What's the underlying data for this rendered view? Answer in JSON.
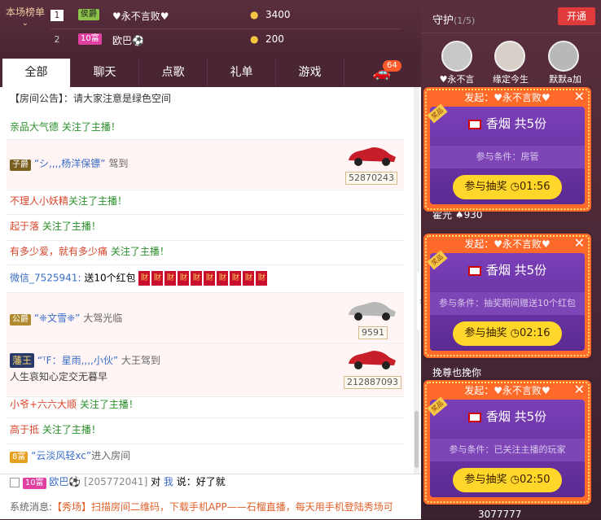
{
  "rank": {
    "label": "本场榜单",
    "chevron": "⌄",
    "rows": [
      {
        "n": "1",
        "badge": "侯爵",
        "name": "♥永不言败♥",
        "amount": "3400"
      },
      {
        "n": "2",
        "badge": "10富",
        "name": "欧巴⚽",
        "amount": "200"
      }
    ]
  },
  "tabs": [
    "全部",
    "聊天",
    "点歌",
    "礼单",
    "游戏"
  ],
  "car_badge": "64",
  "chat": {
    "notice_label": "【房间公告】：",
    "notice": "请大家注意是绿色空间",
    "partial": "亲品大气德 关注了主播！",
    "enter1_badge": "子爵",
    "enter1_name": "“シ,,,,杨洋保镖”",
    "enter1_action": "驾到",
    "enter1_plate": "52870243",
    "f1_name": "不理人小妖精",
    "f1_action": "关注了主播！",
    "f2_name": "起于落",
    "f2_action": "关注了主播！",
    "f3_name": "有多少爱，就有多少痛",
    "f3_action": "关注了主播！",
    "rp_name": "微信_7525941:",
    "rp_text": "送10个红包",
    "rp_char": "财",
    "enter2_badge": "公爵",
    "enter2_name": "“❈文雪❈”",
    "enter2_action": "大驾光临",
    "enter2_plate": "9591",
    "enter3_badge": "藩王",
    "enter3_name": "“ᵀF：星雨,,,,小伙”",
    "enter3_action": "大王驾到",
    "enter3_sub": "人生哀知心定交无暮早",
    "enter3_plate": "212887093",
    "f4_name": "小爷+六六大顺",
    "f4_action": "关注了主播！",
    "f5_name": "高于抵",
    "f5_action": "关注了主播！",
    "enter4_badge": "8富",
    "enter4_name": "“云淡风轻xc”",
    "enter4_action": "进入房间"
  },
  "bottom": {
    "badge": "10富",
    "name": "欧巴⚽",
    "id": "[205772041]",
    "to": "对",
    "me": "我",
    "say": "说：",
    "text": "好了就",
    "sys_label": "系统消息:",
    "sys_text": "【秀场】扫描房间二维码，下载手机APP——石榴直播，每天用手机登陆秀场可"
  },
  "guard": {
    "title": "守护",
    "count": "(1/5)",
    "open": "开通",
    "avatars": [
      "♥永不言",
      "缘定今生",
      "默默a加"
    ]
  },
  "right_list": {
    "row1": "霍光 ♠930",
    "row2": "挽尊也挽你",
    "row3": "3077777"
  },
  "popups": [
    {
      "from": "发起：♥永不言败♥",
      "prize": "香烟 共5份",
      "cond": "参与条件：房管",
      "join": "参与抽奖",
      "time": "01:56"
    },
    {
      "from": "发起：♥永不言败♥",
      "prize": "香烟 共5份",
      "cond": "参与条件：抽奖期间赠送10个红包",
      "join": "参与抽奖",
      "time": "02:16"
    },
    {
      "from": "发起：♥永不言败♥",
      "prize": "香烟 共5份",
      "cond": "参与条件：已关注主播的玩家",
      "join": "参与抽奖",
      "time": "02:50"
    }
  ],
  "ribbon": "奖品",
  "colors": {
    "accent": "#e03a3a",
    "join": "#ffd72a",
    "popup_inner": "#6b34a6"
  }
}
